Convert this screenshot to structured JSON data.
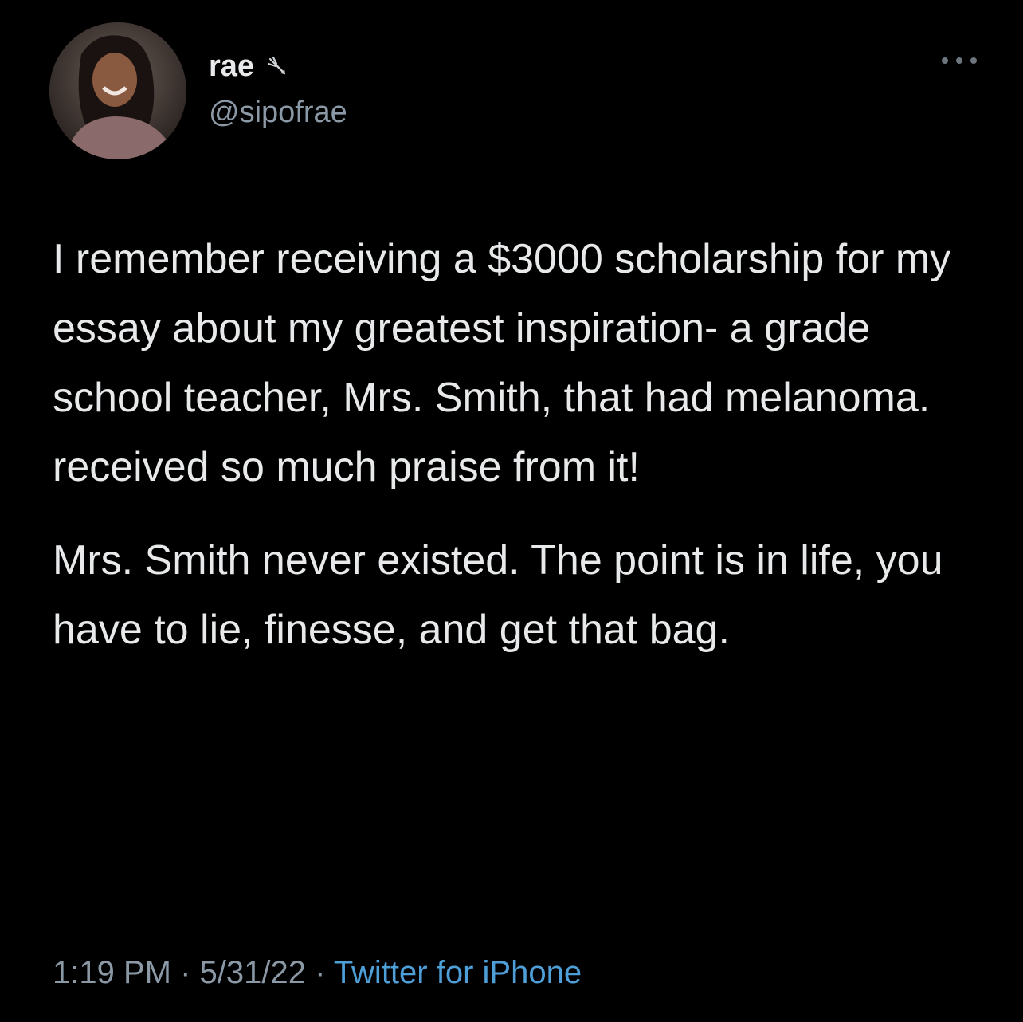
{
  "user": {
    "display_name": "rae",
    "handle": "@sipofrae",
    "name_emoji_icon": "butterfly-icon"
  },
  "tweet": {
    "paragraphs": [
      "I remember receiving a $3000 scholarship for my essay about my greatest inspiration- a grade school teacher, Mrs. Smith, that had melanoma. received so much praise from it!",
      "Mrs. Smith never existed. The point is in life, you have to lie, finesse, and get that bag."
    ]
  },
  "meta": {
    "time": "1:19 PM",
    "separator": " · ",
    "date": "5/31/22",
    "source": "Twitter for iPhone"
  },
  "colors": {
    "background": "#000000",
    "text": "#e7e9ea",
    "muted": "#8b98a5",
    "link": "#4e9ed8"
  }
}
